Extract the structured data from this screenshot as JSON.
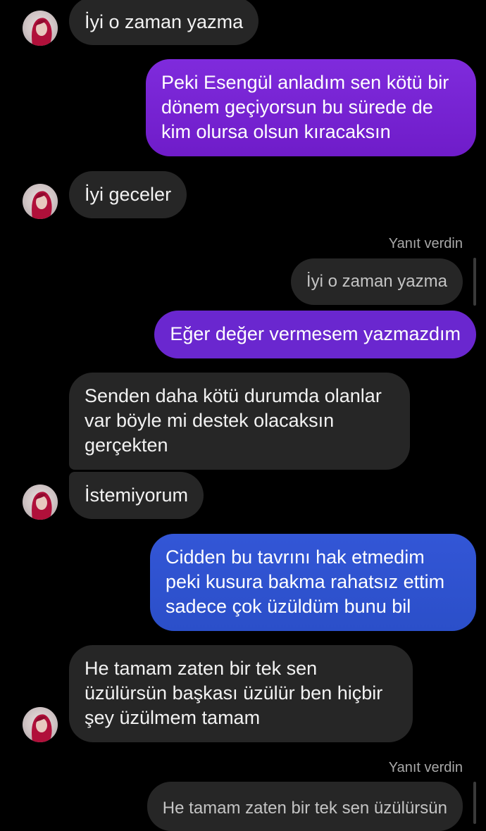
{
  "thread": {
    "messages": [
      {
        "id": "m1",
        "direction": "incoming",
        "text": "İyi o zaman yazma"
      },
      {
        "id": "m2",
        "direction": "outgoing",
        "text": "Peki Esengül anladım sen kötü bir\ndönem geçiyorsun bu sürede de\nkim olursa olsun kıracaksın"
      },
      {
        "id": "m3",
        "direction": "incoming",
        "text": "İyi geceler"
      },
      {
        "id": "m4",
        "direction": "outgoing",
        "reply_label": "Yanıt verdin",
        "replied_text": "İyi o zaman yazma",
        "text": "Eğer değer vermesem yazmazdım"
      },
      {
        "id": "m5",
        "direction": "incoming",
        "text": "Senden daha kötü durumda olanlar\nvar böyle mi destek olacaksın\ngerçekten"
      },
      {
        "id": "m6",
        "direction": "incoming",
        "text": "İstemiyorum"
      },
      {
        "id": "m7",
        "direction": "outgoing",
        "text": "Cidden bu tavrını hak etmedim\npeki kusura bakma rahatsız ettim\nsadece çok üzüldüm bunu bil"
      },
      {
        "id": "m8",
        "direction": "incoming",
        "text": "He tamam zaten bir tek sen\nüzülürsün başkası üzülür ben hiçbir\nşey üzülmem tamam"
      },
      {
        "id": "m9",
        "direction": "outgoing",
        "reply_label": "Yanıt verdin",
        "replied_text": "He tamam zaten bir tek sen üzülürsün"
      }
    ]
  },
  "colors": {
    "background": "#000000",
    "incoming_bubble": "#262626",
    "outgoing_purple": "#7a22d6",
    "outgoing_blue": "#2f56d0"
  },
  "icons": {
    "avatar": "contact-avatar-photo"
  }
}
